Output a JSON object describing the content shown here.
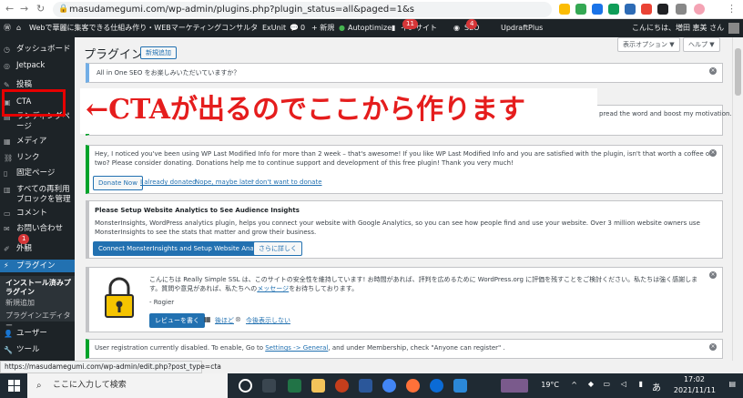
{
  "browser": {
    "url": "masudamegumi.com/wp-admin/plugins.php?plugin_status=all&paged=1&s"
  },
  "adminbar": {
    "site": "Webで華麗に集客できる仕組み作り・WEBマーケティングコンサルタント増田恵美",
    "exunit": "ExUnit",
    "comments": "0",
    "new": "+ 新規",
    "autoptimize": "Autoptimize",
    "insight": "インサイト",
    "insight_count": "11",
    "seo": "SEO",
    "seo_count": "4",
    "updraft": "UpdraftPlus",
    "greeting": "こんにちは、増田 恵美 さん"
  },
  "sidebar": {
    "items": [
      {
        "icon": "dashboard-icon",
        "label": "ダッシュボード"
      },
      {
        "icon": "jetpack-icon",
        "label": "Jetpack"
      },
      {
        "icon": "pin-icon",
        "label": "投稿"
      },
      {
        "icon": "cta-icon",
        "label": "CTA"
      },
      {
        "icon": "landing-icon",
        "label": "ランディングページ"
      },
      {
        "icon": "media-icon",
        "label": "メディア"
      },
      {
        "icon": "link-icon",
        "label": "リンク"
      },
      {
        "icon": "page-icon",
        "label": "固定ページ"
      },
      {
        "icon": "reusable-icon",
        "label": "すべての再利用ブロックを管理"
      },
      {
        "icon": "comment-icon",
        "label": "コメント"
      },
      {
        "icon": "mail-icon",
        "label": "お問い合わせ",
        "badge": "1"
      },
      {
        "icon": "appearance-icon",
        "label": "外観"
      },
      {
        "icon": "plugin-icon",
        "label": "プラグイン"
      }
    ],
    "submenu": [
      "インストール済みプラグイン",
      "新規追加",
      "プラグインエディター"
    ],
    "after": [
      {
        "icon": "user-icon",
        "label": "ユーザー"
      },
      {
        "icon": "tool-icon",
        "label": "ツール"
      }
    ]
  },
  "page": {
    "title": "プラグイン",
    "add_new": "新規追加",
    "screen_options": "表示オプション ▼",
    "help": "ヘルプ ▼"
  },
  "notices": {
    "aioseo": "All in One SEO をお楽しみいただいていますか？",
    "partial": "pread the word and boost my motivation.",
    "lastmod_text": "Hey, I noticed you've been using WP Last Modified Info for more than 2 week – that's awesome! If you like WP Last Modified Info and you are satisfied with the plugin, isn't that worth a coffee or two? Please consider donating. Donations help me to continue support and development of this free plugin! Thank you very much!",
    "donate_now": "Donate Now",
    "already_donated": "I already donated",
    "nope_maybe_later": "Nope, maybe later",
    "dont_want": "I don't want to donate",
    "mi_title": "Please Setup Website Analytics to See Audience Insights",
    "mi_text": "MonsterInsights, WordPress analytics plugin, helps you connect your website with Google Analytics, so you can see how people find and use your website. Over 3 million website owners use MonsterInsights to see the stats that matter and grow their business.",
    "mi_connect": "Connect MonsterInsights and Setup Website Analytics",
    "mi_more": "さらに詳しく",
    "rsssl_text": "こんにちは Really Simple SSL は、このサイトの安全性を維持しています! お時間があれば、評判を広めるために WordPress.org に評価を残すことをご検討ください。私たちは強く感謝します。質問や意見があれば、私たちへの",
    "rsssl_link": "メッセージ",
    "rsssl_text2": "をお待ちしております。",
    "rsssl_sign": "- Rogier",
    "rsssl_review": "レビューを書く",
    "rsssl_later": "後ほど",
    "rsssl_never": "今後表示しない",
    "reg_text1": "User registration currently disabled. To enable, Go to ",
    "reg_link": "Settings -> General",
    "reg_text2": ", and under Membership, check \"Anyone can register\" ."
  },
  "overlay": {
    "text": "←CTAが出るのでここから作ります"
  },
  "statusbar": {
    "url": "https://masudamegumi.com/wp-admin/edit.php?post_type=cta"
  },
  "taskbar": {
    "search": "ここに入力して検索",
    "weather": "19°C",
    "ime": "あ",
    "time": "17:02",
    "date": "2021/11/11"
  },
  "colors": {
    "accent": "#2271b1",
    "overlay_red": "#e51d1d",
    "admin_dark": "#1d2327"
  }
}
